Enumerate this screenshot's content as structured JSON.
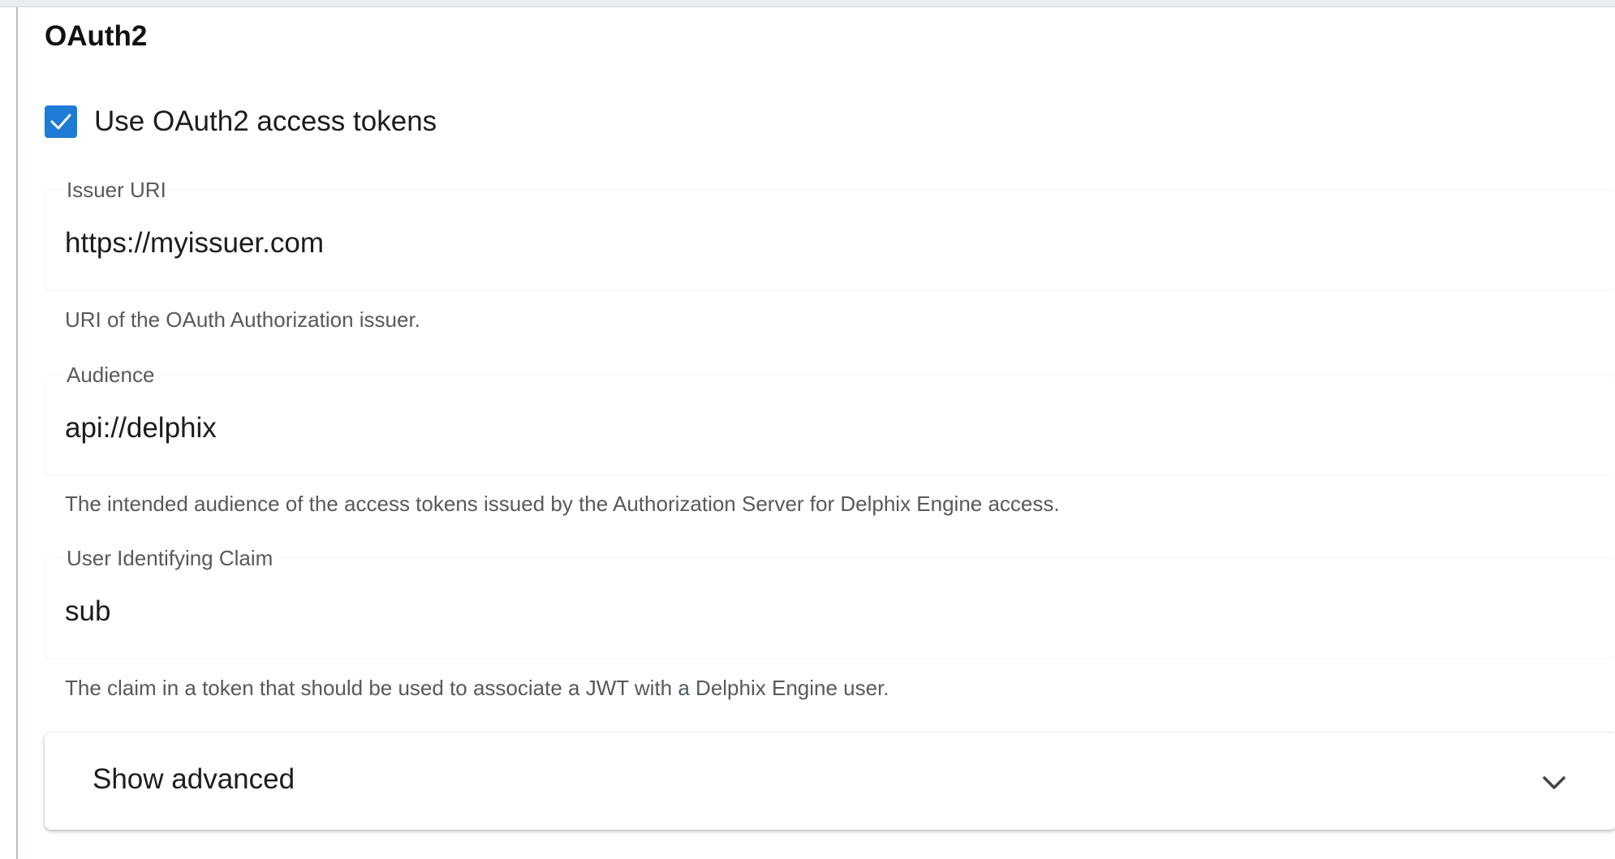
{
  "section": {
    "title": "OAuth2"
  },
  "oauth_toggle": {
    "label": "Use OAuth2 access tokens",
    "checked": true
  },
  "fields": {
    "issuer": {
      "label": "Issuer URI",
      "value": "https://myissuer.com",
      "help": "URI of the OAuth Authorization issuer."
    },
    "audience": {
      "label": "Audience",
      "value": "api://delphix",
      "help": "The intended audience of the access tokens issued by the Authorization Server for Delphix Engine access."
    },
    "claim": {
      "label": "User Identifying Claim",
      "value": "sub",
      "help": "The claim in a token that should be used to associate a JWT with a Delphix Engine user."
    }
  },
  "advanced": {
    "label": "Show advanced",
    "icon": "chevron-down-icon"
  },
  "colors": {
    "accent": "#1e7bd6"
  }
}
